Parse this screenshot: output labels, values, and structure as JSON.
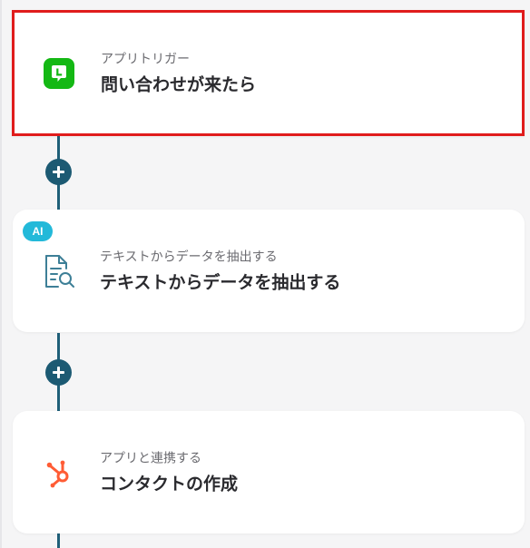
{
  "flow": {
    "steps": [
      {
        "subtitle": "アプリトリガー",
        "title": "問い合わせが来たら",
        "icon": "line-app-icon",
        "selected": true
      },
      {
        "subtitle": "テキストからデータを抽出する",
        "title": "テキストからデータを抽出する",
        "icon": "document-search-icon",
        "badge": "AI"
      },
      {
        "subtitle": "アプリと連携する",
        "title": "コンタクトの作成",
        "icon": "hubspot-icon"
      }
    ]
  },
  "colors": {
    "connector": "#1f5f78",
    "plus_button": "#1c5a73",
    "selection_border": "#e01c1c",
    "ai_badge": "#23b9d9",
    "line_green": "#14b814",
    "hubspot_orange": "#ff5c35",
    "doc_icon": "#3d7f97"
  }
}
